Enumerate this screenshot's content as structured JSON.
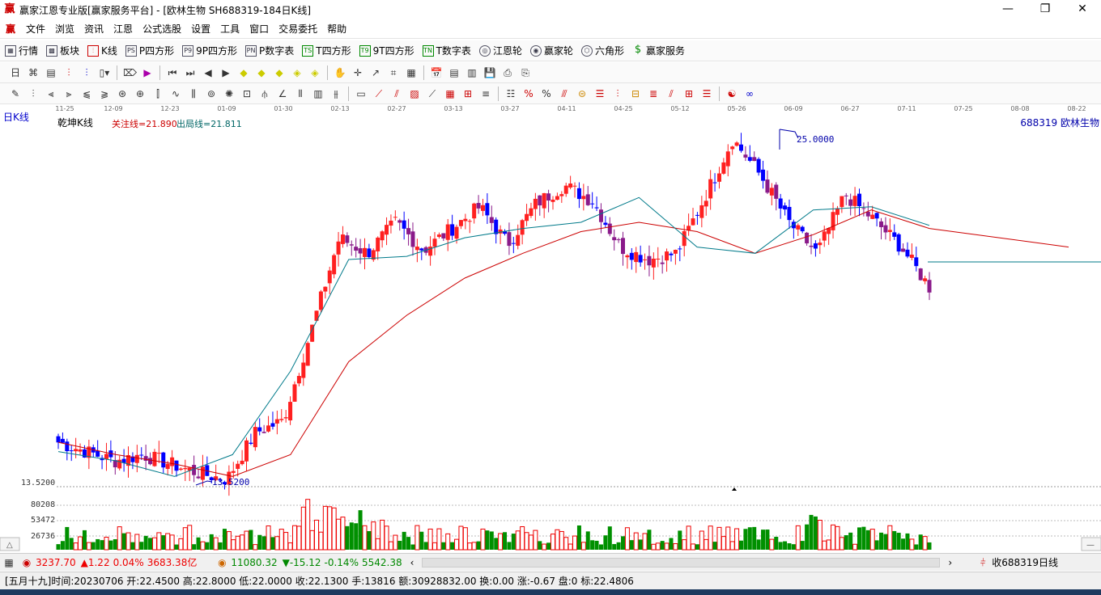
{
  "window": {
    "title": "赢家江恩专业版[赢家服务平台] - [欧林生物   SH688319-184日K线]",
    "minimize": "—",
    "restore": "❐",
    "close": "✕"
  },
  "menu": [
    "文件",
    "浏览",
    "资讯",
    "江恩",
    "公式选股",
    "设置",
    "工具",
    "窗口",
    "交易委托",
    "帮助"
  ],
  "toolbar1": [
    {
      "icon": "grid-icon",
      "label": "行情"
    },
    {
      "icon": "blocks-icon",
      "label": "板块"
    },
    {
      "icon": "candle-icon",
      "label": "K线"
    },
    {
      "icon": "p-square-icon",
      "label": "P四方形"
    },
    {
      "icon": "9p-square-icon",
      "label": "9P四方形"
    },
    {
      "icon": "pn-table-icon",
      "label": "P数字表"
    },
    {
      "icon": "t-square-icon",
      "label": "T四方形"
    },
    {
      "icon": "9t-square-icon",
      "label": "9T四方形"
    },
    {
      "icon": "tn-table-icon",
      "label": "T数字表"
    },
    {
      "icon": "wheel-icon",
      "label": "江恩轮"
    },
    {
      "icon": "winner-wheel-icon",
      "label": "赢家轮"
    },
    {
      "icon": "hexagon-icon",
      "label": "六角形"
    },
    {
      "icon": "dollar-icon",
      "label": "赢家服务"
    }
  ],
  "chart": {
    "period": "日K线",
    "indicator": "乾坤K线",
    "focus_line": "关注线=21.890",
    "exit_line": "出局线=21.811",
    "stock": "688319 欧林生物",
    "high_label": "25.0000",
    "low_label": "13.5200",
    "price_axis_low": "13.5200",
    "volume_ticks": [
      "80208",
      "53472",
      "26736"
    ],
    "dates": [
      "11-25",
      "12-09",
      "12-23",
      "01-09",
      "01-30",
      "02-13",
      "02-27",
      "03-13",
      "03-27",
      "04-11",
      "04-25",
      "05-12",
      "05-26",
      "06-09",
      "06-27",
      "07-11",
      "07-25",
      "08-08",
      "08-22"
    ]
  },
  "chart_data": {
    "type": "candlestick",
    "x": [
      "11-25",
      "12-09",
      "12-23",
      "01-09",
      "01-30",
      "02-13",
      "02-27",
      "03-13",
      "03-27",
      "04-11",
      "04-25",
      "05-12",
      "05-26",
      "06-09",
      "06-27",
      "07-11"
    ],
    "series": [
      {
        "name": "关注线",
        "values": [
          14.6,
          14.3,
          13.8,
          14.5,
          17.2,
          20.8,
          20.9,
          21.5,
          21.8,
          22.0,
          22.8,
          21.2,
          21.0,
          22.4,
          22.5,
          21.9
        ]
      },
      {
        "name": "出局线",
        "values": [
          14.9,
          14.5,
          14.2,
          13.8,
          14.5,
          17.5,
          19.0,
          20.2,
          21.0,
          21.7,
          22.0,
          21.7,
          21.0,
          21.6,
          22.4,
          21.8
        ]
      }
    ],
    "high": 25.0,
    "low": 13.52,
    "volume_ticks": [
      26736,
      53472,
      80208
    ],
    "xlabel": "",
    "ylabel": ""
  },
  "scroll": {
    "index1_value": "3237.70",
    "index1_change": "▲1.22",
    "index1_pct": "0.04%",
    "index1_amount": "3683.38亿",
    "index2_value": "11080.32",
    "index2_change": "▼-15.12",
    "index2_pct": "-0.14%",
    "index2_amount": "5542.38",
    "right_label": "收688319日线"
  },
  "status": {
    "lunar": "[五月十九]",
    "info": "时间:20230706 开:22.4500 高:22.8000 低:22.0000 收:22.1300 手:13816 额:30928832.00 换:0.00 涨:-0.67 盘:0 标:22.4806"
  }
}
